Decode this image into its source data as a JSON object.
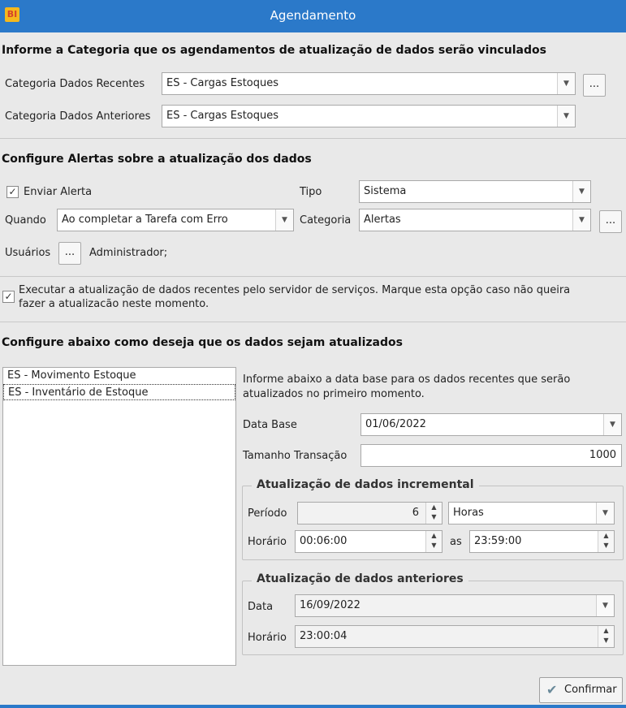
{
  "window": {
    "title": "Agendamento",
    "icon_text": "BI",
    "accent": "#2b79c9"
  },
  "categoria": {
    "heading": "Informe a Categoria que os agendamentos de atualização de dados serão vinculados",
    "recentes_label": "Categoria Dados Recentes",
    "recentes_value": "ES - Cargas Estoques",
    "anteriores_label": "Categoria Dados Anteriores",
    "anteriores_value": "ES - Cargas Estoques",
    "dots_label": "..."
  },
  "alertas": {
    "heading": "Configure Alertas sobre a atualização dos dados",
    "enviar_label": "Enviar Alerta",
    "enviar_checked": true,
    "tipo_label": "Tipo",
    "tipo_value": "Sistema",
    "quando_label": "Quando",
    "quando_value": "Ao completar a Tarefa com Erro",
    "categoria_label": "Categoria",
    "categoria_value": "Alertas",
    "usuarios_label": "Usuários",
    "usuarios_value": "Administrador;",
    "dots_label": "..."
  },
  "servidor": {
    "checked": true,
    "text_line1": "Executar a atualização de dados recentes pelo servidor de serviços.  Marque esta opção caso não queira",
    "text_line2": "fazer a atualizacão neste momento."
  },
  "config": {
    "heading": "Configure abaixo como deseja que os dados sejam atualizados",
    "list_items": [
      "ES - Movimento Estoque",
      "ES - Inventário de Estoque"
    ],
    "selected_index": 1,
    "info_line1": "Informe abaixo a data base para os dados recentes que serão",
    "info_line2": "atualizados no primeiro momento.",
    "data_base_label": "Data Base",
    "data_base_value": "01/06/2022",
    "tamanho_label": "Tamanho Transação",
    "tamanho_value": "1000"
  },
  "incremental": {
    "title": "Atualização de dados incremental",
    "periodo_label": "Período",
    "periodo_value": "6",
    "unidade_value": "Horas",
    "horario_label": "Horário",
    "horario_inicio": "00:06:00",
    "as_label": "as",
    "horario_fim": "23:59:00"
  },
  "anteriores": {
    "title": "Atualização de dados anteriores",
    "data_label": "Data",
    "data_value": "16/09/2022",
    "horario_label": "Horário",
    "horario_value": "23:00:04"
  },
  "footer": {
    "confirm_label": "Confirmar"
  }
}
